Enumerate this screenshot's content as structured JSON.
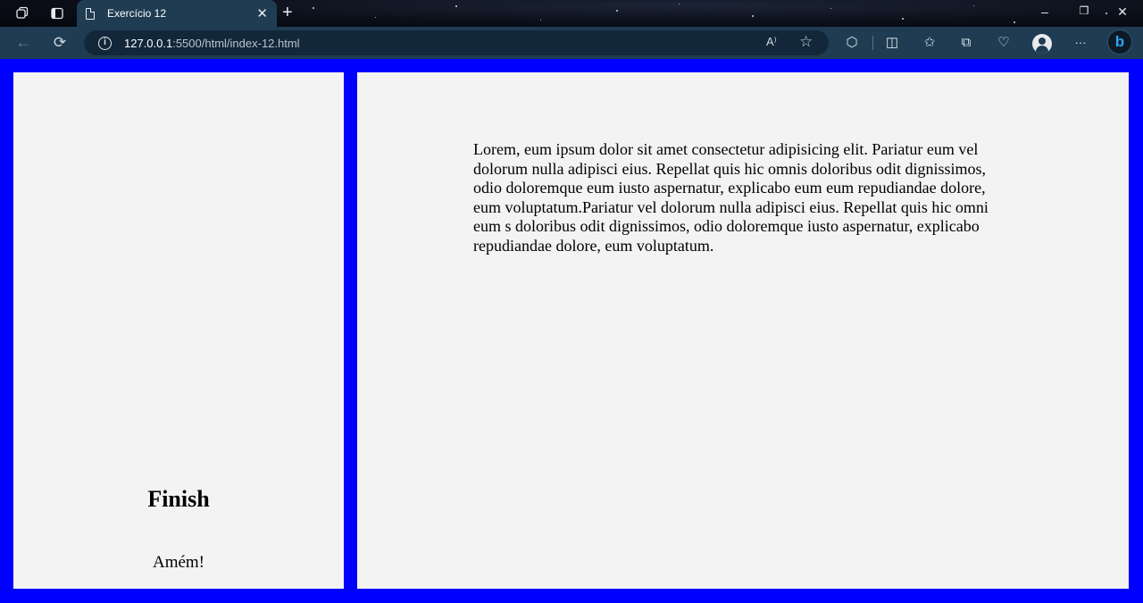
{
  "browser": {
    "tab": {
      "title": "Exercício 12"
    },
    "address": {
      "host": "127.0.0.1",
      "path": ":5500/html/index-12.html"
    },
    "icons": {
      "workspaces": "workspaces-icon",
      "tab_actions": "tab-actions-icon",
      "new_tab": "+",
      "back": "←",
      "refresh": "⟳",
      "read_aloud": "A⁾",
      "favorite": "☆",
      "extensions": "⬡",
      "split_screen": "◫",
      "favorites": "✩",
      "collections": "⧉",
      "performance": "♡",
      "more": "···",
      "bing": "b"
    },
    "window": {
      "minimize": "–",
      "restore": "❐",
      "close": "✕"
    }
  },
  "page": {
    "left": {
      "heading": "Finish",
      "caption": "Amém!"
    },
    "right": {
      "paragraph": "Lorem, eum ipsum dolor sit amet consectetur adipisicing elit. Pariatur eum vel dolorum nulla adipisci eius. Repellat quis hic omnis doloribus odit dignissimos, odio doloremque eum iusto aspernatur, explicabo eum eum repudiandae dolore, eum voluptatum.Pariatur vel dolorum nulla adipisci eius. Repellat quis hic omni eum s doloribus odit dignissimos, odio doloremque iusto aspernatur, explicabo repudiandae dolore, eum voluptatum."
    }
  },
  "colors": {
    "page_background": "#0000ff",
    "panel_background": "#f3f3f4",
    "toolbar": "#1f3c52"
  }
}
